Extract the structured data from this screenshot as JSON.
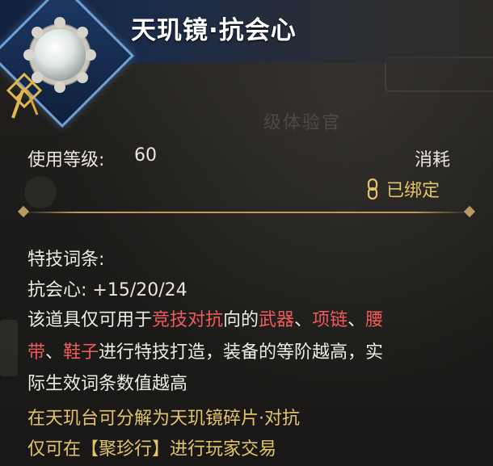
{
  "item": {
    "name": "天玑镜·抗会心",
    "icon": "mirror-orb-icon"
  },
  "info": {
    "level_label": "使用等级:",
    "level_value": "60",
    "item_type": "消耗",
    "bind_status": "已绑定",
    "bind_icon": "chain-link-icon"
  },
  "description": {
    "section_title": "特技词条:",
    "stat_name": "抗会心:",
    "stat_value": "+15/20/24",
    "line1": [
      "该道具仅可用于",
      "竞技对抗",
      "向的",
      "武器",
      "、",
      "项链",
      "、",
      "腰"
    ],
    "line2": [
      "带",
      "、",
      "鞋子",
      "进行特技打造，装备的等阶越高，实"
    ],
    "line3": "际生效词条数值越高",
    "decompose": "在天玑台可分解为天玑镜碎片·对抗",
    "trade": "仅可在【聚珍行】进行玩家交易"
  },
  "background_ghost_text": "级体验官",
  "colors": {
    "header_blue": "#1b2b4a",
    "icon_border": "#6fa0d6",
    "gold": "#e4c46a",
    "red_keyword": "#f05a5a"
  }
}
